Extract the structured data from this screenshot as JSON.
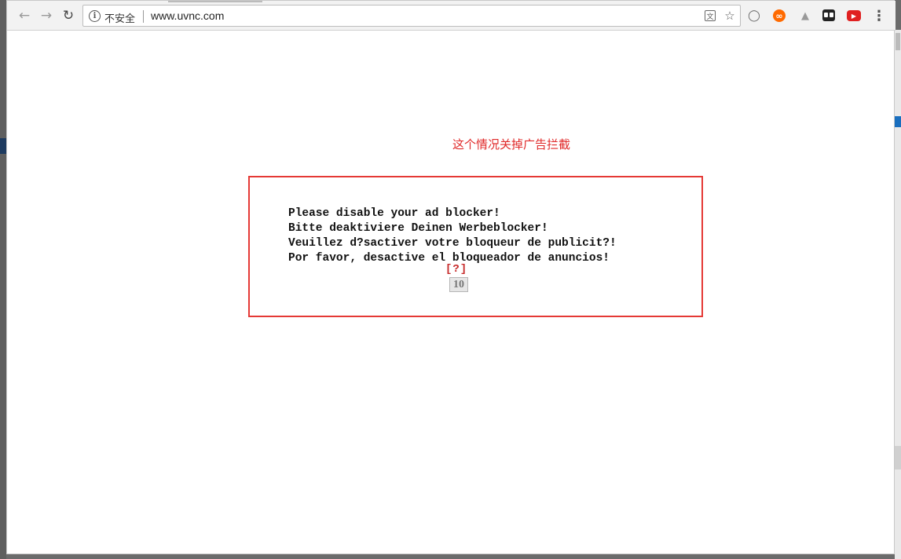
{
  "browser": {
    "security_label": "不安全",
    "url": "www.uvnc.com",
    "nav": {
      "back_icon": "back-arrow-icon",
      "forward_icon": "forward-arrow-icon",
      "reload_icon": "reload-icon"
    },
    "omnibox_icons": [
      "translate-icon",
      "star-icon"
    ],
    "extensions": [
      "adblock-shield-icon",
      "infinity-icon",
      "tree-icon",
      "grid-icon",
      "video-icon"
    ],
    "menu_icon": "more-vert-icon"
  },
  "page": {
    "annotation": "这个情况关掉广告拦截",
    "message_lines": [
      "Please disable your ad blocker!",
      "Bitte deaktiviere Deinen Werbeblocker!",
      "Veuillez d?sactiver votre bloqueur de publicit?!",
      "Por favor, desactive el bloqueador de anuncios!"
    ],
    "help_link": "[?]",
    "countdown": "10"
  },
  "colors": {
    "annotation": "#e02a2a",
    "highlight_border": "#e53935",
    "help_link": "#c62828"
  }
}
